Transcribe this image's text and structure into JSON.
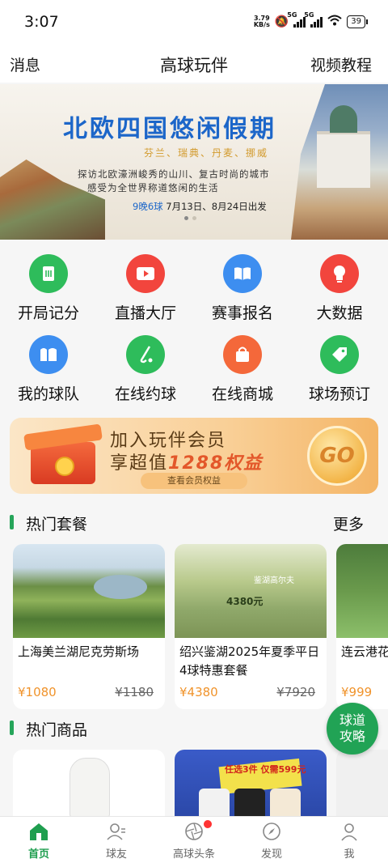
{
  "status_bar": {
    "time": "3:07",
    "net_speed_value": "3.79",
    "net_speed_unit": "KB/s",
    "sim1": "5G",
    "sim2": "5G",
    "battery": "39"
  },
  "header": {
    "left": "消息",
    "title": "高球玩伴",
    "right": "视频教程"
  },
  "banner": {
    "title": "北欧四国悠闲假期",
    "subtitle": "芬兰、瑞典、丹麦、挪威",
    "line1": "探访北欧濠洲峻秀的山川、复古时尚的城市",
    "line2": "感受为全世界称道悠闲的生活",
    "info_highlight": "9晚6球",
    "info_dates": "7月13日、8月24日出发"
  },
  "grid": [
    {
      "label": "开局记分",
      "icon": "scorecard-icon",
      "color": "#2ebc5b"
    },
    {
      "label": "直播大厅",
      "icon": "live-video-icon",
      "color": "#f2453d"
    },
    {
      "label": "赛事报名",
      "icon": "book-icon",
      "color": "#3d8ef0"
    },
    {
      "label": "大数据",
      "icon": "lightbulb-icon",
      "color": "#f2453d"
    },
    {
      "label": "我的球队",
      "icon": "team-icon",
      "color": "#3d8ef0"
    },
    {
      "label": "在线约球",
      "icon": "golf-club-icon",
      "color": "#2ebc5b"
    },
    {
      "label": "在线商城",
      "icon": "shopping-bag-icon",
      "color": "#f4683a"
    },
    {
      "label": "球场预订",
      "icon": "tag-icon",
      "color": "#2ebc5b"
    }
  ],
  "member": {
    "line1": "加入玩伴会员",
    "line2_prefix": "享超值",
    "line2_highlight": "1288权益",
    "pill": "查看会员权益",
    "go": "GO"
  },
  "hot_packages": {
    "title": "热门套餐",
    "more": "更多",
    "items": [
      {
        "name": "上海美兰湖尼克劳斯场",
        "price": "¥1080",
        "old_price": "¥1180"
      },
      {
        "name": "绍兴鉴湖2025年夏季平日4球特惠套餐",
        "price": "¥4380",
        "old_price": "¥7920",
        "image_title": "鉴湖高尔夫",
        "image_price": "4380元"
      },
      {
        "name": "连云港花惠套餐",
        "price": "¥999",
        "old_price": ""
      }
    ]
  },
  "float_button": {
    "line1": "球道",
    "line2": "攻略"
  },
  "hot_goods": {
    "title": "热门商品",
    "items": [
      {
        "caption": ""
      },
      {
        "caption": "任选3件 仅需599元"
      }
    ]
  },
  "tabbar": [
    {
      "label": "首页",
      "icon": "home-icon",
      "active": true
    },
    {
      "label": "球友",
      "icon": "friends-icon",
      "active": false
    },
    {
      "label": "高球头条",
      "icon": "aperture-icon",
      "active": false
    },
    {
      "label": "发现",
      "icon": "compass-icon",
      "active": false
    },
    {
      "label": "我",
      "icon": "person-icon",
      "active": false
    }
  ]
}
